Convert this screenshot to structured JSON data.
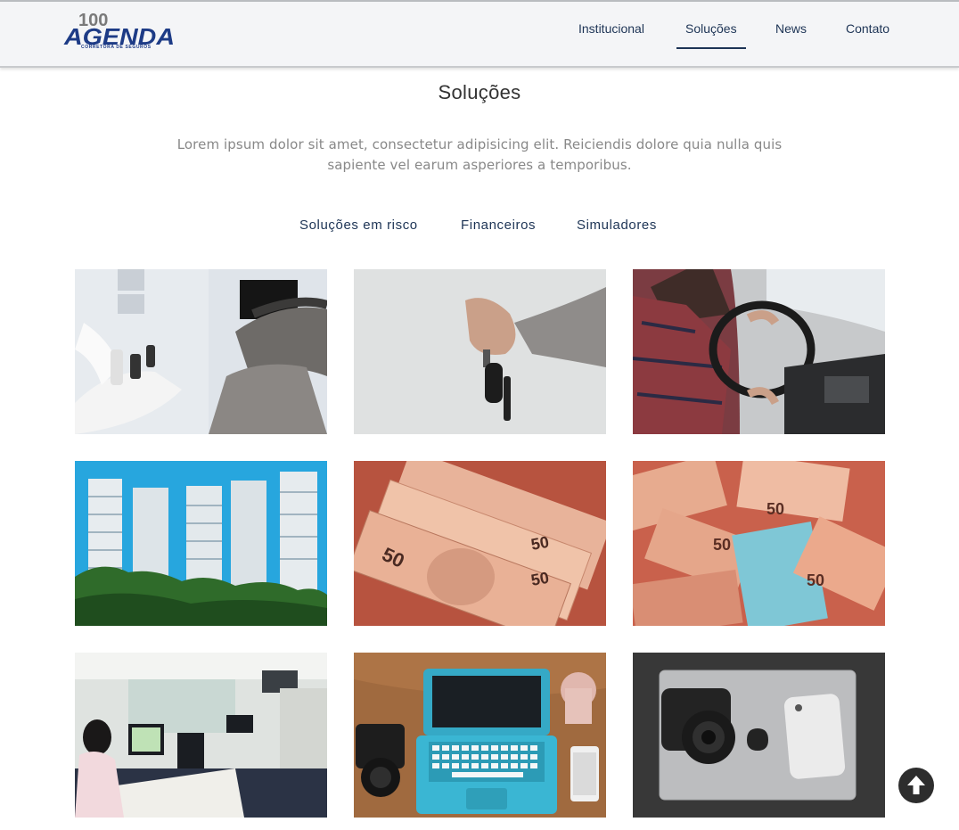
{
  "header": {
    "logo": {
      "number": "100",
      "brand": "AGENDA",
      "tagline": "CORRETORA DE SEGUROS",
      "color": "#1d3b86"
    },
    "nav": [
      {
        "label": "Institucional",
        "active": false
      },
      {
        "label": "Soluções",
        "active": true
      },
      {
        "label": "News",
        "active": false
      },
      {
        "label": "Contato",
        "active": false
      }
    ]
  },
  "main": {
    "title": "Soluções",
    "lead": "Lorem ipsum dolor sit amet, consectetur adipisicing elit. Reiciendis dolore quia nulla quis sapiente vel earum asperiores a temporibus.",
    "filters": [
      "Soluções em risco",
      "Financeiros",
      "Simuladores"
    ],
    "gallery": [
      {
        "subject": "dental-office"
      },
      {
        "subject": "car-key"
      },
      {
        "subject": "driving"
      },
      {
        "subject": "buildings"
      },
      {
        "subject": "banknotes-fan"
      },
      {
        "subject": "banknotes-scattered"
      },
      {
        "subject": "office-workers"
      },
      {
        "subject": "laptop-camera-desk"
      },
      {
        "subject": "macbook-iphone-camera"
      }
    ]
  },
  "back_to_top": {
    "icon": "arrow-up-icon"
  },
  "colors": {
    "accent": "#1d3455",
    "muted_text": "#888888",
    "header_bg": "#f4f5f7"
  }
}
